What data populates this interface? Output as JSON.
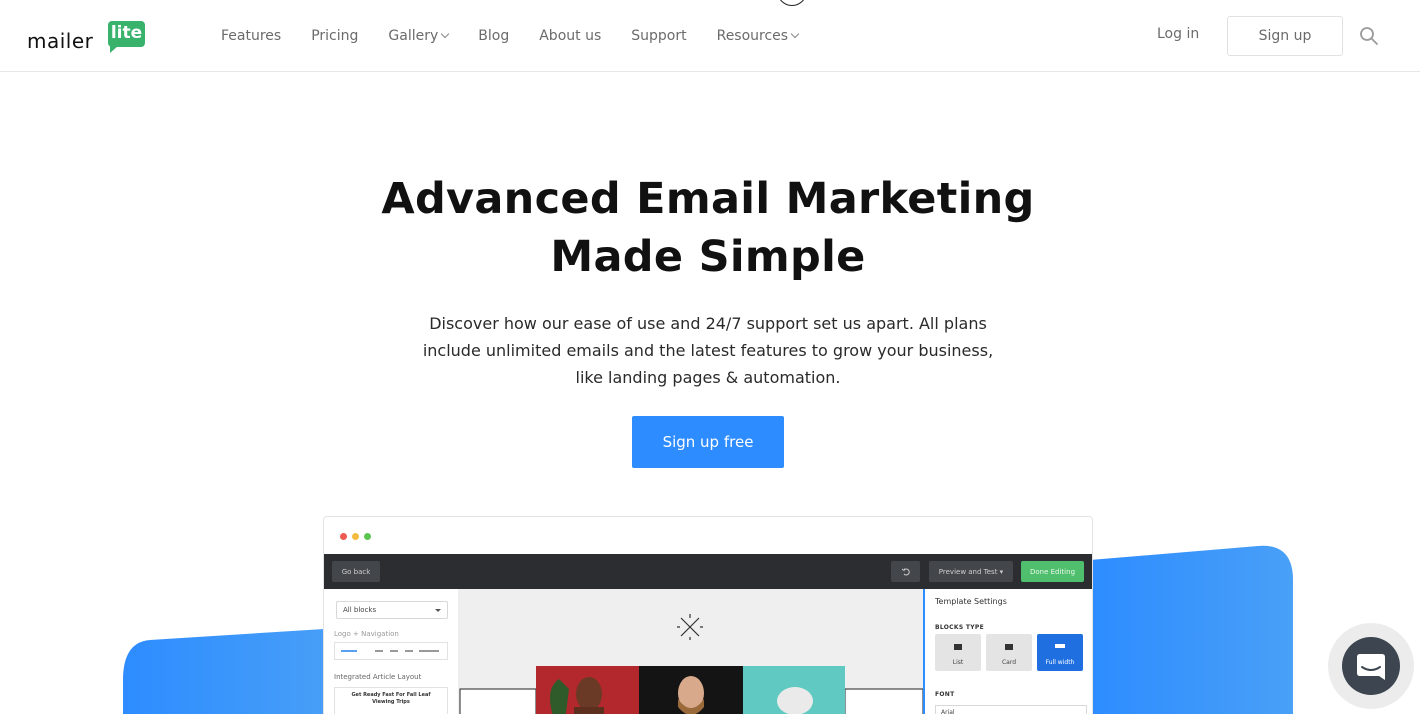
{
  "header": {
    "logo": {
      "word": "mailer",
      "badge": "lite"
    },
    "nav": [
      {
        "label": "Features",
        "has_dropdown": false
      },
      {
        "label": "Pricing",
        "has_dropdown": false
      },
      {
        "label": "Gallery",
        "has_dropdown": true
      },
      {
        "label": "Blog",
        "has_dropdown": false
      },
      {
        "label": "About us",
        "has_dropdown": false
      },
      {
        "label": "Support",
        "has_dropdown": false
      },
      {
        "label": "Resources",
        "has_dropdown": true
      }
    ],
    "login_label": "Log in",
    "signup_label": "Sign up",
    "search_icon": "search-icon"
  },
  "hero": {
    "title_line1": "Advanced Email Marketing",
    "title_line2": "Made Simple",
    "subtitle": "Discover how our ease of use and 24/7 support set us apart. All plans include unlimited emails and the latest features to grow your business, like landing pages & automation.",
    "cta_label": "Sign up free"
  },
  "editor_preview": {
    "toolbar": {
      "back_label": "Go back",
      "preview_label": "Preview and Test ▾",
      "done_label": "Done Editing"
    },
    "left_panel": {
      "filter_value": "All blocks",
      "section1": "Logo + Navigation",
      "section2": "Integrated Article Layout",
      "card_text": "Get Ready Fast For Fall Leaf Viewing Trips"
    },
    "right_panel": {
      "title": "Template Settings",
      "blocks_type_label": "BLOCKS TYPE",
      "block_options": [
        "List",
        "Card",
        "Full width"
      ],
      "selected_block": "Full width",
      "font_label": "FONT",
      "font_value": "Arial"
    }
  },
  "colors": {
    "brand_green": "#39b36c",
    "cta_blue": "#2d8cff",
    "backdrop_blue": "#3a93f5",
    "window_dots": [
      "#ee5b55",
      "#f4bb3f",
      "#5cc552"
    ]
  },
  "chat_widget": {
    "icon": "chat-icon"
  }
}
